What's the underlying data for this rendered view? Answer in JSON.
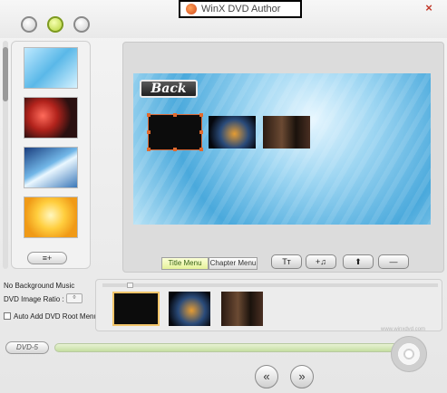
{
  "window": {
    "title": "WinX DVD Author",
    "close_glyph": "×"
  },
  "templates": {
    "add_button_label": "≡+"
  },
  "preview": {
    "back_button_label": "Back"
  },
  "tabs": [
    {
      "label": "Title Menu"
    },
    {
      "label": "Chapter Menu"
    }
  ],
  "tools": {
    "text_label": "Tт",
    "music_label": "+♫",
    "upload_label": "⬆",
    "delete_label": "—"
  },
  "options": {
    "music_label": "No Background Music",
    "ratio_label": "DVD Image Ratio :",
    "ratio_value": "◊",
    "auto_add_label": "Auto Add DVD Root Menu"
  },
  "timeline": {
    "watermark": "www.winxdvd.com"
  },
  "bottom": {
    "dvd_badge": "DVD-5",
    "prev_label": "«",
    "next_label": "»"
  },
  "colors": {
    "accent_tab": "#e6f39a",
    "selection_handle": "#e06a2e"
  }
}
